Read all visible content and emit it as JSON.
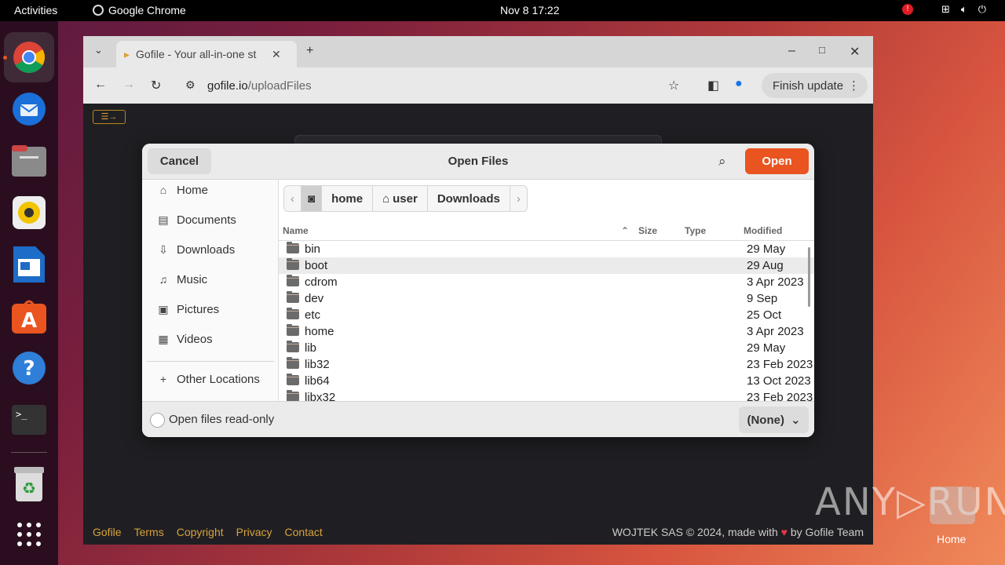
{
  "topbar": {
    "activities": "Activities",
    "app_name": "Google Chrome",
    "clock": "Nov 8  17:22"
  },
  "browser": {
    "tab_title": "Gofile - Your all-in-one st",
    "url_host": "gofile.io",
    "url_path": "/uploadFiles",
    "finish_update": "Finish update",
    "menu_button": "☰→"
  },
  "dialog": {
    "cancel": "Cancel",
    "title": "Open Files",
    "open": "Open",
    "sidebar": [
      {
        "label": "Home",
        "icon": "home-icon"
      },
      {
        "label": "Documents",
        "icon": "documents-icon"
      },
      {
        "label": "Downloads",
        "icon": "download-icon"
      },
      {
        "label": "Music",
        "icon": "music-icon"
      },
      {
        "label": "Pictures",
        "icon": "pictures-icon"
      },
      {
        "label": "Videos",
        "icon": "videos-icon"
      },
      {
        "label": "Other Locations",
        "icon": "plus-icon"
      }
    ],
    "path": [
      "home",
      "user",
      "Downloads"
    ],
    "columns": {
      "name": "Name",
      "size": "Size",
      "type": "Type",
      "modified": "Modified"
    },
    "files": [
      {
        "name": "bin",
        "modified": "29 May"
      },
      {
        "name": "boot",
        "modified": "29 Aug",
        "selected": true
      },
      {
        "name": "cdrom",
        "modified": "3 Apr 2023"
      },
      {
        "name": "dev",
        "modified": "9 Sep"
      },
      {
        "name": "etc",
        "modified": "25 Oct"
      },
      {
        "name": "home",
        "modified": "3 Apr 2023"
      },
      {
        "name": "lib",
        "modified": "29 May"
      },
      {
        "name": "lib32",
        "modified": "23 Feb 2023"
      },
      {
        "name": "lib64",
        "modified": "13 Oct 2023"
      },
      {
        "name": "libx32",
        "modified": "23 Feb 2023"
      }
    ],
    "readonly_label": "Open files read-only",
    "filter": "(None)"
  },
  "page_footer": {
    "links": [
      "Gofile",
      "Terms",
      "Copyright",
      "Privacy",
      "Contact"
    ],
    "copyright_prefix": "WOJTEK SAS © 2024, made with",
    "copyright_suffix": "by Gofile Team"
  },
  "desktop": {
    "home_label": "Home",
    "watermark": "ANY RUN"
  },
  "colors": {
    "accent": "#e95420",
    "link": "#d9a23a"
  }
}
